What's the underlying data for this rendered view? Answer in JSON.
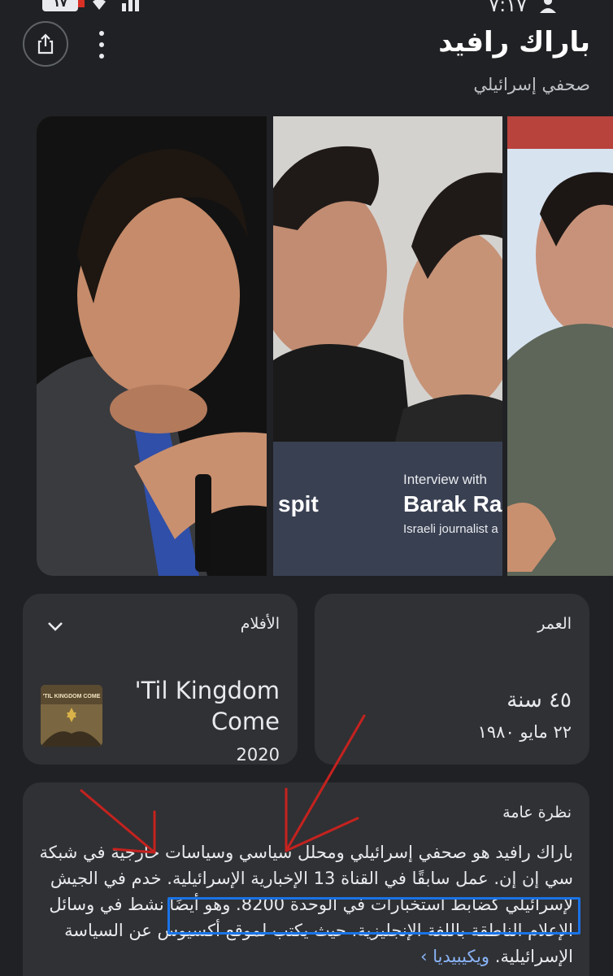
{
  "status_bar": {
    "battery": "١٧",
    "time": "٧:١٧"
  },
  "header": {
    "title": "باراك رافيد",
    "subtitle": "صحفي إسرائيلي",
    "share_icon": "share-icon",
    "more_icon": "more-vert-icon"
  },
  "gallery": {
    "photo2": {
      "caption_small": "Interview with",
      "caption_big": "Barak Ra",
      "caption_sub": "Israeli journalist a",
      "caption_left": "spit"
    }
  },
  "films_card": {
    "label": "الأفلام",
    "movie_title": "'Til Kingdom Come",
    "movie_year": "2020",
    "poster_text": "'TIL KINGDOM COME"
  },
  "age_card": {
    "label": "العمر",
    "value": "٤٥ سنة",
    "birth_date": "٢٢ مايو ١٩٨٠"
  },
  "overview": {
    "label": "نظرة عامة",
    "text": "باراك رافيد هو صحفي إسرائيلي ومحلل سياسي وسياسات خارجية في شبكة سي إن إن. عمل سابقًا في القناة 13 الإخبارية الإسرائيلية. خدم في الجيش لإسرائيلي كضابط استخبارات في الوحدة 8200. وهو أيضًا نشط في وسائل الإعلام الناطقة باللغة الإنجليزية، حيث يكتب لموقع أكسيوس عن السياسة الإسرائيلية.",
    "source_link": "ويكيبيديا",
    "link_arrow": "›"
  },
  "colors": {
    "background": "#202124",
    "card": "#303134",
    "highlight": "#1a73e8",
    "annotation_arrows": "#c5221f"
  }
}
